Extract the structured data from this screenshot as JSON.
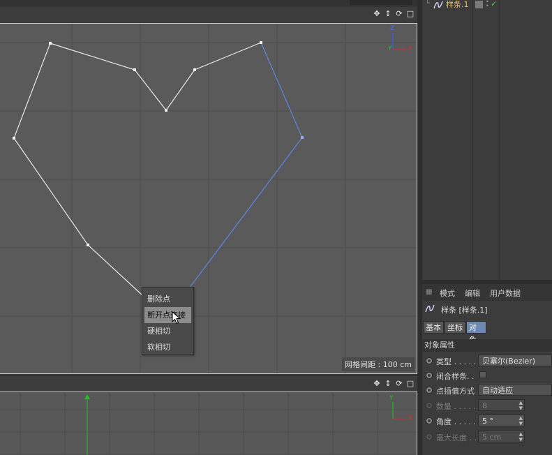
{
  "object_manager": {
    "object_name": "样条.1",
    "visible_check": "✓"
  },
  "viewport_top": {
    "grid_spacing_label": "网格间距 : 100 cm",
    "axis_labels": {
      "z": "Z",
      "y": "Y",
      "x": "X"
    },
    "nav_icons": [
      "move-view-icon",
      "dolly-view-icon",
      "rotate-view-icon",
      "maximize-view-icon"
    ]
  },
  "context_menu": {
    "items": [
      {
        "label": "删除点",
        "highlighted": false
      },
      {
        "label": "断开点连接",
        "highlighted": true
      },
      {
        "label": "硬相切",
        "highlighted": false
      },
      {
        "label": "软相切",
        "highlighted": false
      }
    ]
  },
  "viewport_bottom": {
    "axis_labels": {
      "y": "Y",
      "x": "X"
    }
  },
  "attributes": {
    "menu": [
      "模式",
      "编辑",
      "用户数据"
    ],
    "title": "样条 [样条.1]",
    "tabs": [
      {
        "label": "基本",
        "active": false
      },
      {
        "label": "坐标",
        "active": false
      },
      {
        "label": "对象",
        "active": true
      }
    ],
    "section": "对象属性",
    "props": {
      "type_label": "类型 . . . . .",
      "type_value": "贝塞尔(Bezier)",
      "close_label": "闭合样条. .",
      "interp_label": "点插值方式",
      "interp_value": "自动适应",
      "count_label": "数量 . . . . .",
      "count_value": "8",
      "angle_label": "角度 . . . . .",
      "angle_value": "5 °",
      "maxlen_label": "最大长度 . .",
      "maxlen_value": "5 cm"
    }
  },
  "colors": {
    "spline_white": "#e8e8ee",
    "spline_blue": "#5b86d6",
    "axis_z": "#3b59ff",
    "axis_y": "#1ec71e",
    "axis_x": "#e02a2a",
    "tab_active": "#6d89b3"
  }
}
